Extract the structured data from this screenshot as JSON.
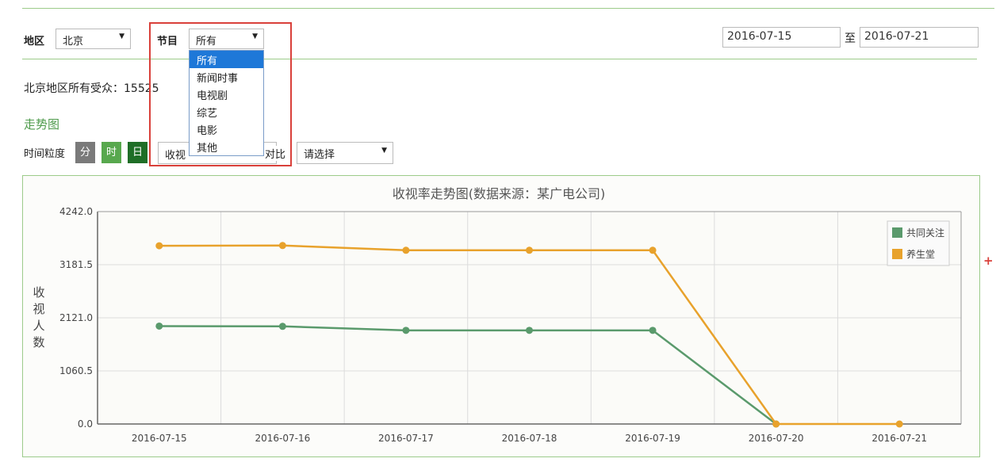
{
  "filters": {
    "region_label": "地区",
    "region_value": "北京",
    "program_label": "节目",
    "program_value": "所有",
    "program_options": [
      "所有",
      "新闻时事",
      "电视剧",
      "综艺",
      "电影",
      "其他"
    ],
    "date_from": "2016-07-15",
    "date_separator": "至",
    "date_to": "2016-07-21"
  },
  "summary": {
    "audience_text": "北京地区所有受众：15525"
  },
  "trend": {
    "title": "走势图",
    "granularity_label": "时间粒度",
    "granularity_buttons": [
      {
        "label": "分",
        "color": "#7a7a7a"
      },
      {
        "label": "时",
        "color": "#58a84e"
      },
      {
        "label": "日",
        "color": "#1f6e27"
      }
    ],
    "metric_value": "收视",
    "compare_label": "对比",
    "compare_value": "请选择"
  },
  "chart_data": {
    "type": "line",
    "title": "收视率走势图(数据来源：某广电公司)",
    "ylabel": "收视人数",
    "xlabel": "",
    "categories": [
      "2016-07-15",
      "2016-07-16",
      "2016-07-17",
      "2016-07-18",
      "2016-07-19",
      "2016-07-20",
      "2016-07-21"
    ],
    "y_ticks": [
      "0.0",
      "1060.5",
      "2121.0",
      "3181.5",
      "4242.0"
    ],
    "ylim": [
      0,
      4242
    ],
    "grid": true,
    "legend_position": "top-right",
    "series": [
      {
        "name": "共同关注",
        "color": "#5a9a6c",
        "values": [
          1955,
          1950,
          1870,
          1870,
          1870,
          0,
          null
        ]
      },
      {
        "name": "养生堂",
        "color": "#e8a22c",
        "values": [
          3560,
          3565,
          3470,
          3470,
          3470,
          0,
          0
        ]
      }
    ]
  },
  "colors": {
    "accent_green": "#4e9a4b",
    "highlight_red": "#d9403a",
    "dropdown_selected": "#1e78d8"
  }
}
